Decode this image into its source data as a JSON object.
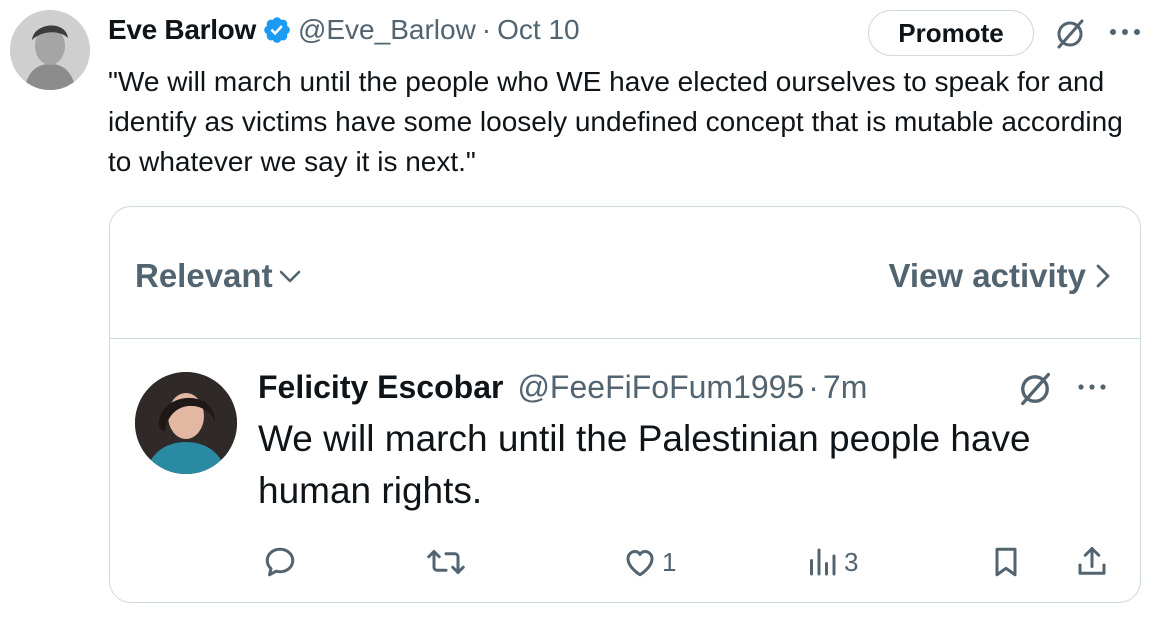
{
  "tweet": {
    "author_name": "Eve Barlow",
    "handle": "@Eve_Barlow",
    "separator": "·",
    "date": "Oct 10",
    "promote_label": "Promote",
    "text": "\"We will march until the people who WE have elected ourselves to speak for and identify as victims have some loosely undefined concept that is mutable according to whatever we say it is next.\""
  },
  "quote": {
    "sort_label": "Relevant",
    "view_activity_label": "View activity",
    "reply": {
      "name": "Felicity Escobar",
      "handle": "@FeeFiFoFum1995",
      "separator": "·",
      "time": "7m",
      "text": "We will march until the Palestinian people have human rights.",
      "likes": "1",
      "views": "3"
    }
  },
  "icons": {
    "verified": "verified-badge-icon",
    "grok": "grok-icon",
    "more": "more-icon",
    "chevron_down": "chevron-down-icon",
    "chevron_right": "chevron-right-icon",
    "reply": "reply-icon",
    "retweet": "retweet-icon",
    "like": "heart-icon",
    "views": "views-icon",
    "bookmark": "bookmark-icon",
    "share": "share-icon"
  },
  "colors": {
    "text": "#0f1419",
    "secondary": "#536471",
    "border": "#cfd9de",
    "verified_blue": "#1d9bf0"
  }
}
